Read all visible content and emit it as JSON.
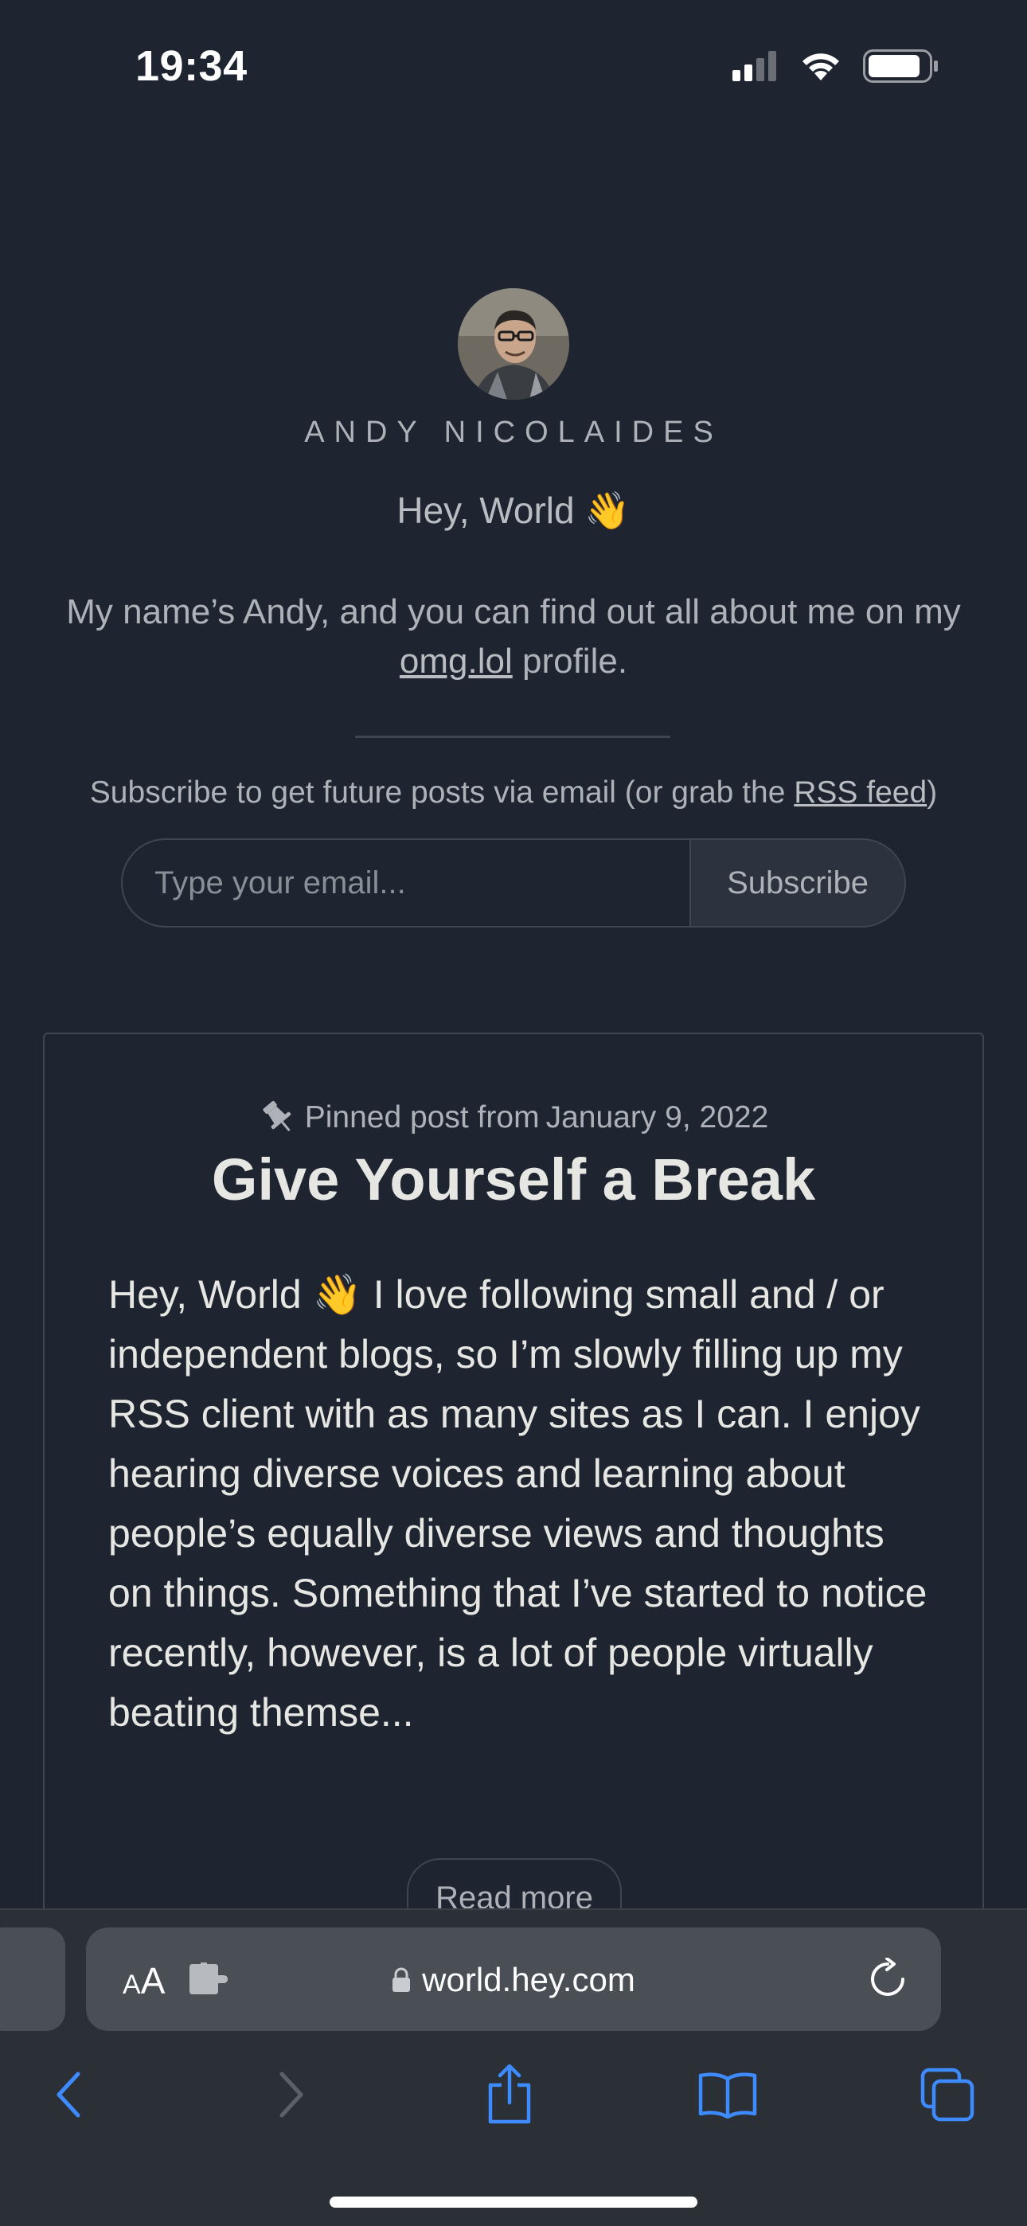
{
  "status_bar": {
    "time": "19:34"
  },
  "header": {
    "author_name": "ANDY NICOLAIDES",
    "greeting": "Hey, World 👋",
    "intro_before": "My name’s Andy, and you can find out all about me on my ",
    "intro_link": "omg.lol",
    "intro_after": " profile."
  },
  "subscribe": {
    "text_before": "Subscribe to get future posts via email (or grab the ",
    "rss_link": "RSS feed",
    "text_after": ")",
    "email_placeholder": "Type your email...",
    "button_label": "Subscribe"
  },
  "pinned_post": {
    "pinned_label": "Pinned post from",
    "date": "January 9, 2022",
    "title": "Give Yourself a Break",
    "excerpt": "Hey, World 👋 I love following small and / or independent blogs, so I’m slowly filling up my RSS client with as many sites as I can. I enjoy hearing diverse voices and learning about people’s equally diverse views and thoughts on things. Something that I’ve started to notice recently, however, is a lot of people virtually beating themse...",
    "read_more_label": "Read more"
  },
  "browser": {
    "aa_small": "A",
    "aa_large": "A",
    "url": "world.hey.com",
    "toolbar_icons": [
      "back-icon",
      "forward-icon",
      "share-icon",
      "bookmarks-icon",
      "tabs-icon"
    ],
    "accent_color": "#3d8bff"
  }
}
